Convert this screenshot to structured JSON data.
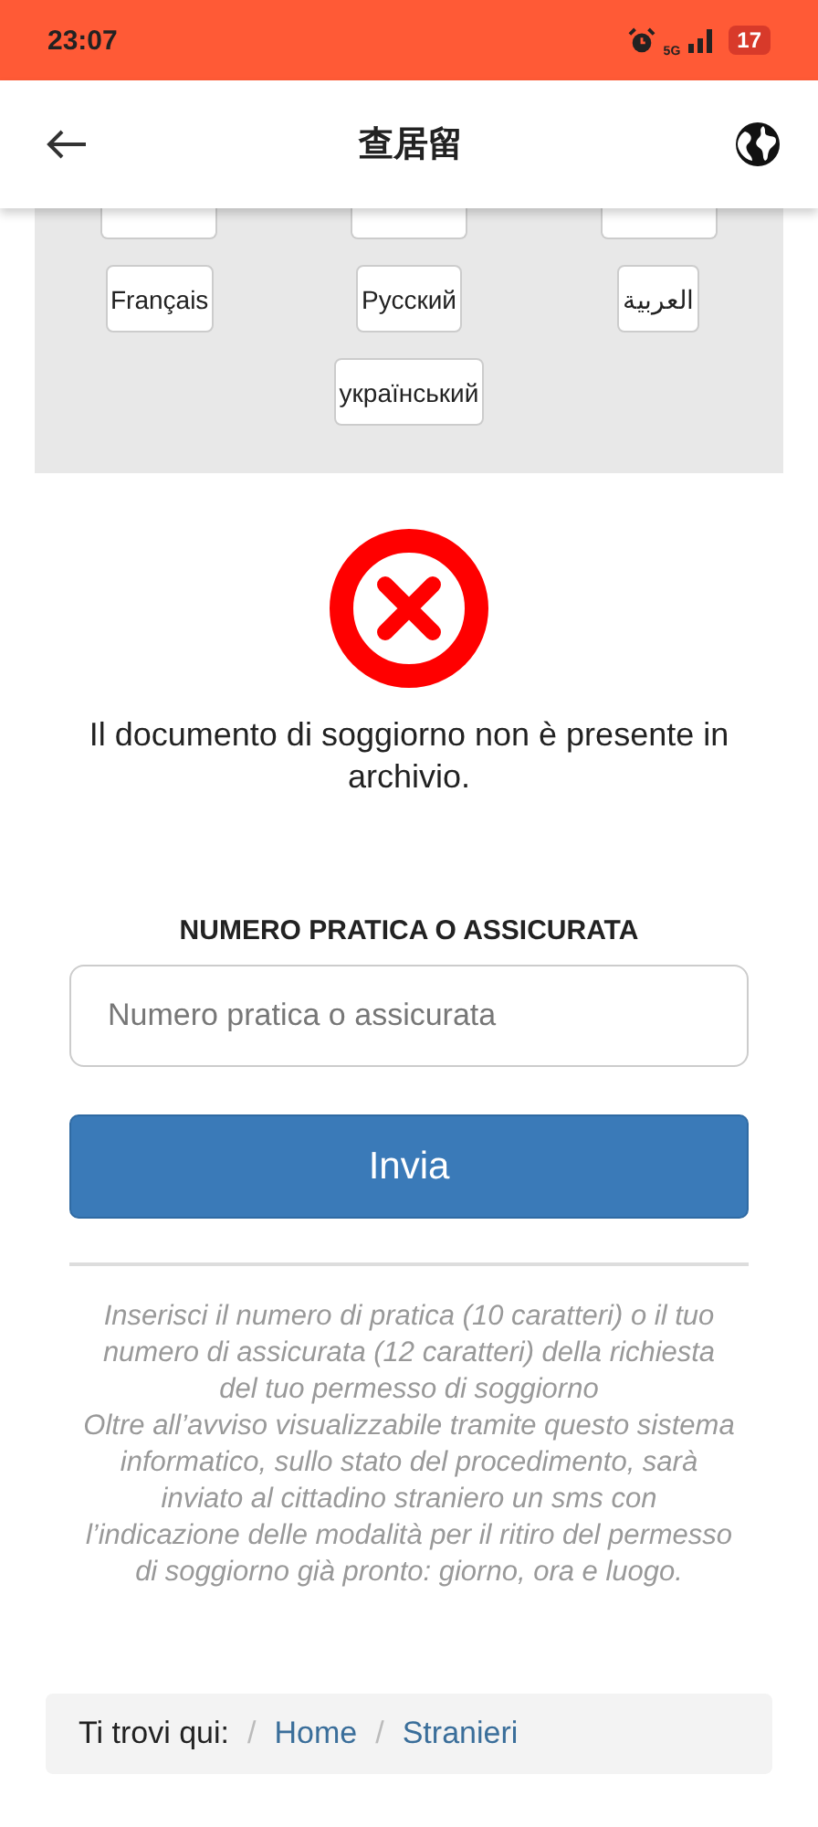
{
  "status_bar": {
    "time": "23:07",
    "network": "5G",
    "battery": "17"
  },
  "header": {
    "title": "查居留"
  },
  "languages": [
    "Français",
    "Русский",
    "العربية",
    "український"
  ],
  "result": {
    "kind": "error",
    "message": "Il documento di soggiorno non è presente in archivio."
  },
  "form": {
    "label": "NUMERO PRATICA O ASSICURATA",
    "placeholder": "Numero pratica o assicurata",
    "button": "Invia"
  },
  "help": [
    "Inserisci il numero di pratica (10 caratteri) o il tuo numero di assicurata (12 caratteri) della richiesta del tuo permesso di soggiorno",
    "Oltre all’avviso visualizzabile tramite questo sistema informatico, sullo stato del procedimento, sarà inviato al cittadino straniero un sms con l’indicazione delle modalità per il ritiro del permesso di soggiorno già pronto: giorno, ora e luogo."
  ],
  "breadcrumb": {
    "label": "Ti trovi qui:",
    "separator": "/",
    "links": [
      "Home",
      "Stranieri"
    ]
  }
}
